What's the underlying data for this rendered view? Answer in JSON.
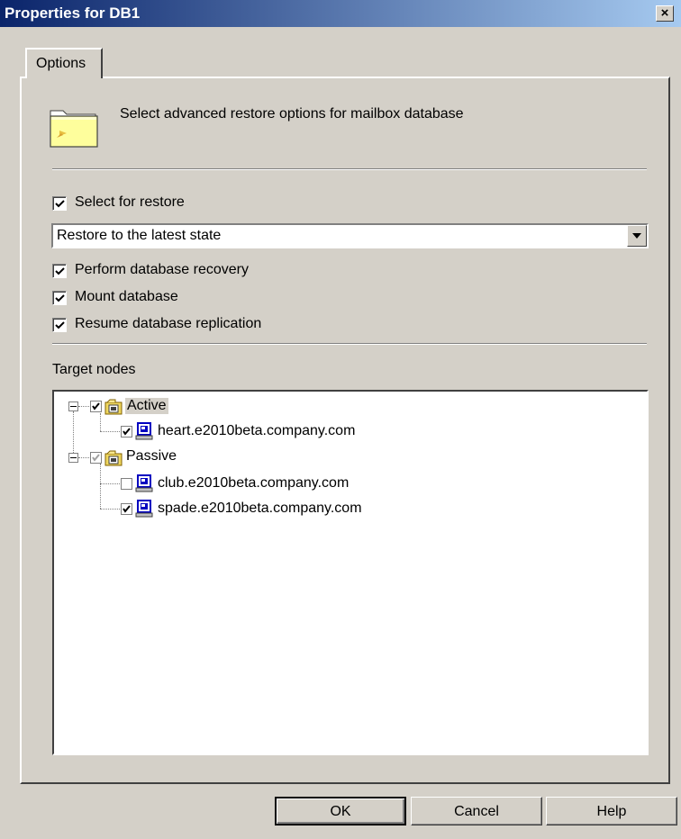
{
  "window": {
    "title": "Properties for DB1",
    "close_label": "×"
  },
  "tabs": [
    {
      "label": "Options"
    }
  ],
  "header": {
    "description": "Select advanced restore options for mailbox database",
    "icon": "folder-icon"
  },
  "options": {
    "select_for_restore": {
      "label": "Select for restore",
      "checked": true
    },
    "restore_mode": {
      "selected": "Restore to the latest state"
    },
    "perform_recovery": {
      "label": "Perform database recovery",
      "checked": true
    },
    "mount_database": {
      "label": "Mount database",
      "checked": true
    },
    "resume_replication": {
      "label": "Resume database replication",
      "checked": true
    }
  },
  "target_nodes": {
    "label": "Target nodes",
    "groups": [
      {
        "name": "Active",
        "checked": true,
        "nodes": [
          {
            "name": "heart.e2010beta.company.com",
            "checked": true
          }
        ]
      },
      {
        "name": "Passive",
        "checked": "partial",
        "nodes": [
          {
            "name": "club.e2010beta.company.com",
            "checked": false
          },
          {
            "name": "spade.e2010beta.company.com",
            "checked": true
          }
        ]
      }
    ]
  },
  "buttons": {
    "ok": "OK",
    "cancel": "Cancel",
    "help": "Help"
  },
  "colors": {
    "titlebar_start": "#0a246a",
    "titlebar_end": "#a6caf0",
    "face": "#d4d0c8",
    "computer_icon": "#0000c0"
  }
}
